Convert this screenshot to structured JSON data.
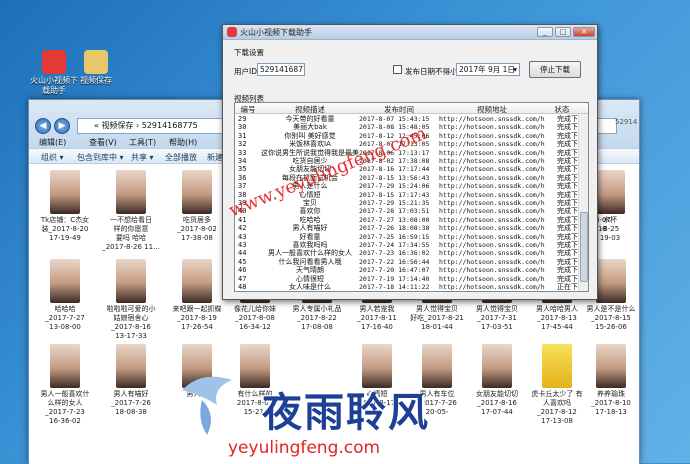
{
  "desktop": {
    "icons": [
      {
        "label": "火山小视频下载助手",
        "color": "#e53935"
      },
      {
        "label": "视频保存",
        "color": "#e8c66a"
      }
    ]
  },
  "explorer": {
    "address": "« 视频保存 › 52914168775",
    "search_partial": "52914",
    "menus": [
      "编辑(E)",
      "查看(V)",
      "工具(T)",
      "帮助(H)"
    ],
    "toolbar": [
      "组织 ▾",
      "包含到库中 ▾",
      "共享 ▾",
      "全部播放",
      "新建文"
    ],
    "tiles_row1": [
      "Tk店铺：C杰女\n装_2017-8-20\n17-19-49",
      "一不想给看日\n样的你愿意\n要吗 哈哈\n_2017-8-26 11...",
      "吃货居多\n_2017-8-02\n17-38-08",
      "",
      "",
      "",
      "",
      "",
      "",
      "",
      "_2017-8-07\n17-57-18",
      "",
      "水杯\n-8-25\n19-03"
    ],
    "tiles_row2": [
      "哈哈哈\n_2017-7-27\n13-08-00",
      "啦啦啦可爱的小\n姑娘宿舍心\n_2017-8-16\n13-17-33",
      "来吧跟一起抓蝶\n_2017-8-19\n17-26-54",
      "像花儿给你妹\n_2017-8-08\n16-34-12",
      "男人专属小礼品\n_2017-8-22\n17-08-08",
      "男人若宠我\n_2017-8-11\n17-16-40",
      "男人觉得宝贝\n好吃_2017-8-21\n18-01-44",
      "男人觉得宝贝\n_2017-7-31\n17-03-51",
      "男人哈哈男人\n_2017-8-13\n17-45-44",
      "男人是不是什么\n_2017-8-15\n15-26-06"
    ],
    "tiles_row3": [
      "男人一般喜欢什\n么样的女人\n_2017-7-23\n16-36-02",
      "男人有喵好\n_2017-7-26\n18-08-38",
      "男人的",
      "有什么样的\n2017-8-07\n15-21-",
      "",
      "心情短\n2017-8-17",
      "男人有车位\n_2017-7-26\n20-05-",
      "女朋友能切切\n_2017-8-16\n17-07-44",
      "虎卡丘太少了 有\n人喜欢吗\n_2017-8-12\n17-13-08",
      "养养瑜珠\n_2017-8-10\n17-18-13"
    ]
  },
  "downloader": {
    "title": "火山小视频下载助手",
    "section_settings": "下载设置",
    "user_id_label": "用户ID:",
    "user_id_value": "52914168775",
    "date_filter_label": "发布日期不得小于:",
    "date_value": "2017年 9月 1日",
    "stop_button": "停止下载",
    "section_list": "视频列表",
    "columns": [
      "编号",
      "视频描述",
      "发布时间",
      "视频地址",
      "状态"
    ],
    "rows": [
      {
        "id": "29",
        "desc": "今天带的好看童",
        "time": "2017-8-07 15:43:15",
        "url": "http://hotsoon.snssdk.com/hotsoon/i...",
        "status": "完成下载"
      },
      {
        "id": "30",
        "desc": "美丽大bak",
        "time": "2017-8-08 15:48:05",
        "url": "http://hotsoon.snssdk.com/hotsoon/i...",
        "status": "完成下载"
      },
      {
        "id": "31",
        "desc": "你别叫 美好感觉",
        "time": "2017-8-12 12:45:06",
        "url": "http://hotsoon.snssdk.com/hotsoon/i...",
        "status": "完成下载"
      },
      {
        "id": "32",
        "desc": "米饭林喜欢IA",
        "time": "2017-8-07 17:13:05",
        "url": "http://hotsoon.snssdk.com/hotsoon/i...",
        "status": "完成下载"
      },
      {
        "id": "33",
        "desc": "这你说男生所说我觉得我是最美",
        "time": "2017-8-06 17:13:17",
        "url": "http://hotsoon.snssdk.com/hotsoon/i...",
        "status": "完成下载"
      },
      {
        "id": "34",
        "desc": "吃货自居少",
        "time": "2017-8-02 17:38:08",
        "url": "http://hotsoon.snssdk.com/hotsoon/i...",
        "status": "完成下载"
      },
      {
        "id": "35",
        "desc": "女朋友能切切",
        "time": "2017-8-16 17:17:44",
        "url": "http://hotsoon.snssdk.com/hotsoon/i...",
        "status": "完成下载"
      },
      {
        "id": "36",
        "desc": "每段在抓面试机会",
        "time": "2017-8-15 13:56:43",
        "url": "http://hotsoon.snssdk.com/hotsoon/i...",
        "status": "完成下载"
      },
      {
        "id": "37",
        "desc": "男人是什么",
        "time": "2017-7-29 15:24:06",
        "url": "http://hotsoon.snssdk.com/hotsoon/i...",
        "status": "完成下载"
      },
      {
        "id": "38",
        "desc": "心情短",
        "time": "2017-8-15 17:17:43",
        "url": "http://hotsoon.snssdk.com/hotsoon/i...",
        "status": "完成下载"
      },
      {
        "id": "39",
        "desc": "宝贝",
        "time": "2017-7-29 15:21:35",
        "url": "http://hotsoon.snssdk.com/hotsoon/i...",
        "status": "完成下载"
      },
      {
        "id": "40",
        "desc": "喜欢你",
        "time": "2017-7-28 17:03:51",
        "url": "http://hotsoon.snssdk.com/hotsoon/i...",
        "status": "完成下载"
      },
      {
        "id": "41",
        "desc": "吃哈哈",
        "time": "2017-7-27 13:08:00",
        "url": "http://hotsoon.snssdk.com/hotsoon/i...",
        "status": "完成下载"
      },
      {
        "id": "42",
        "desc": "男人有喵好",
        "time": "2017-7-26 18:08:38",
        "url": "http://hotsoon.snssdk.com/hotsoon/i...",
        "status": "完成下载"
      },
      {
        "id": "43",
        "desc": "好看童",
        "time": "2017-7-25 16:59:15",
        "url": "http://hotsoon.snssdk.com/hotsoon/i...",
        "status": "完成下载"
      },
      {
        "id": "43",
        "desc": "喜欢我吗吗",
        "time": "2017-7-24 17:34:55",
        "url": "http://hotsoon.snssdk.com/hotsoon/i...",
        "status": "完成下载"
      },
      {
        "id": "44",
        "desc": "男人一般喜欢什么样的女人",
        "time": "2017-7-23 16:36:02",
        "url": "http://hotsoon.snssdk.com/hotsoon/i...",
        "status": "完成下载"
      },
      {
        "id": "45",
        "desc": "什么我问看看男人哦",
        "time": "2017-7-22 16:56:44",
        "url": "http://hotsoon.snssdk.com/hotsoon/i...",
        "status": "完成下载"
      },
      {
        "id": "46",
        "desc": "天气晴朗",
        "time": "2017-7-20 16:47:07",
        "url": "http://hotsoon.snssdk.com/hotsoon/i...",
        "status": "完成下载"
      },
      {
        "id": "47",
        "desc": "心情很短",
        "time": "2017-7-19 17:14:40",
        "url": "http://hotsoon.snssdk.com/hotsoon/i...",
        "status": "完成下载"
      },
      {
        "id": "48",
        "desc": "女人味是什么",
        "time": "2017-7-18 14:11:22",
        "url": "http://hotsoon.snssdk.com/hotsoon/i...",
        "status": "正在下载"
      }
    ]
  },
  "watermark": {
    "diagonal": "www.yeyulingfeng.com",
    "brand_cn": "夜雨聆风",
    "brand_url": "yeyulingfeng.com",
    "color_red": "#e02525",
    "color_blue": "#1d3f95"
  }
}
